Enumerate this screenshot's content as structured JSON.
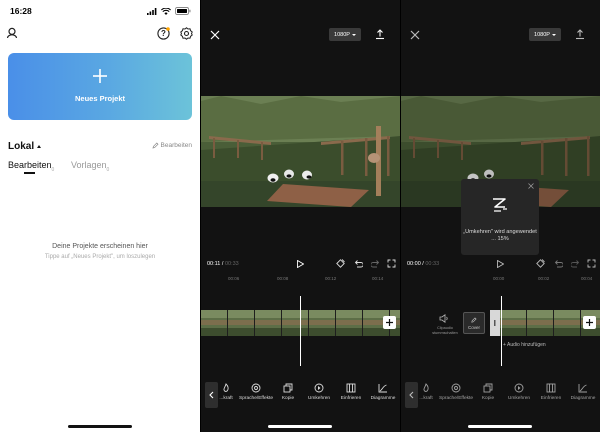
{
  "home": {
    "status_time": "16:28",
    "new_project_label": "Neues Projekt",
    "section_title": "Lokal",
    "edit_label": "Bearbeiten",
    "tabs": [
      {
        "label": "Bearbeiten",
        "count": "0"
      },
      {
        "label": "Vorlagen",
        "count": "0"
      }
    ],
    "empty_title": "Deine Projekte erscheinen hier",
    "empty_hint": "Tippe auf „Neues Projekt\", um loszulegen"
  },
  "editor": {
    "resolution": "1080P",
    "current_time": "00:11",
    "total_time": "00:33",
    "ruler_marks": [
      "00:06",
      "00:08",
      "00:12",
      "00:14"
    ],
    "tools": [
      "...kraft",
      "Sprache/Effekte",
      "Kopie",
      "Umkehren",
      "Einfrieren",
      "Diagramme"
    ]
  },
  "editor_reverse": {
    "resolution": "1080P",
    "current_time": "00:00",
    "total_time": "00:33",
    "ruler_marks": [
      "00:00",
      "00:02",
      "00:04"
    ],
    "mute_label": "Clipaudio stummschalten",
    "cover_label": "Cover",
    "add_audio": "Audio hinzufügen",
    "toast_text": "„Umkehren\" wird angewendet ... 15%",
    "tools": [
      "...kraft",
      "Sprache/Effekte",
      "Kopie",
      "Umkehren",
      "Einfrieren",
      "Diagramme"
    ]
  }
}
